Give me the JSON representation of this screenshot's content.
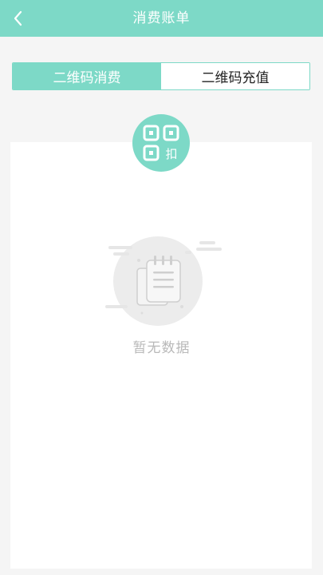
{
  "header": {
    "title": "消费账单",
    "back_icon": "chevron-left-icon"
  },
  "tabs": [
    {
      "label": "二维码消费",
      "active": true
    },
    {
      "label": "二维码充值",
      "active": false
    }
  ],
  "badge": {
    "icon": "qr-code-icon",
    "char": "扣"
  },
  "empty_state": {
    "icon": "document-icon",
    "text": "暂无数据"
  },
  "colors": {
    "accent": "#7dd9c7",
    "background": "#f5f5f5",
    "empty_text": "#b9b9b9"
  }
}
